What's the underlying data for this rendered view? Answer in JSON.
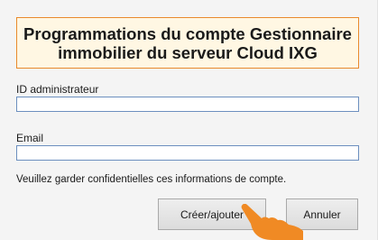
{
  "dialog": {
    "title_line1": "Programmations du compte Gestionnaire",
    "title_line2": "immobilier du serveur Cloud IXG"
  },
  "form": {
    "admin_id_label": "ID administrateur",
    "admin_id_value": "",
    "email_label": "Email",
    "email_value": "",
    "note": "Veuillez garder confidentielles ces informations de compte."
  },
  "buttons": {
    "create_label": "Créer/ajouter",
    "cancel_label": "Annuler"
  },
  "colors": {
    "title_border": "#e98a2c",
    "title_background": "#fff7e3",
    "field_border": "#6c8fbf",
    "pointer": "#f08a24"
  },
  "icons": {
    "pointer": "pointing-hand-icon"
  }
}
